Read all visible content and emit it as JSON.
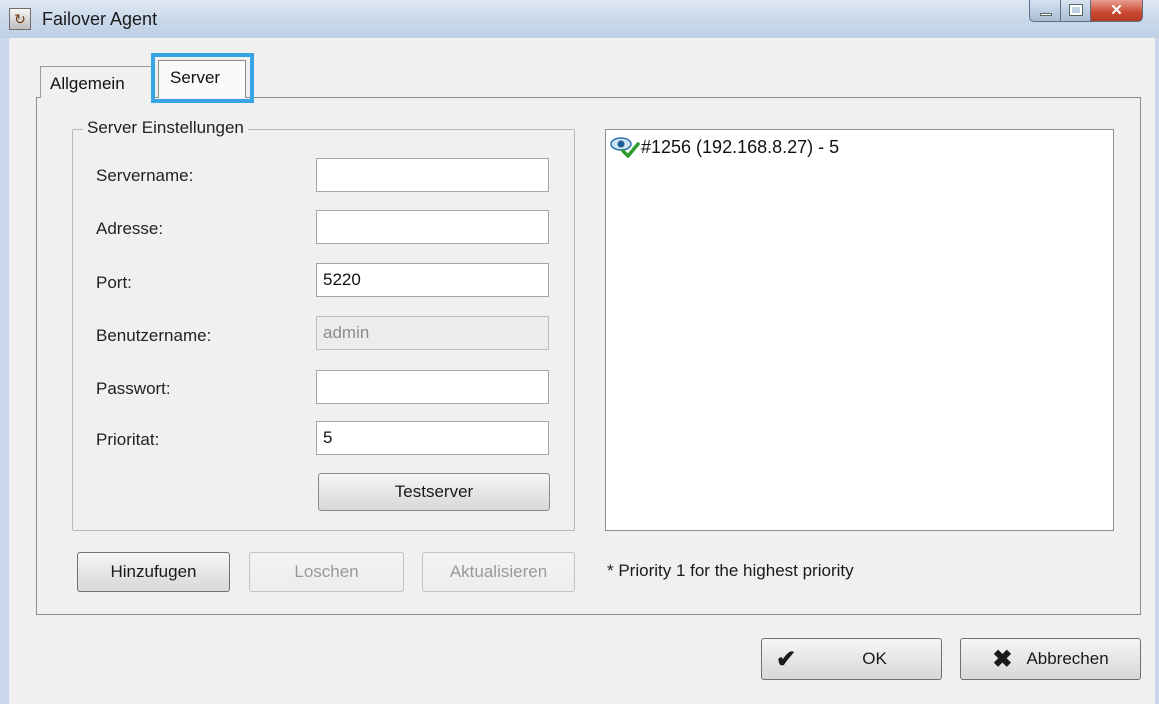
{
  "window": {
    "title": "Failover Agent"
  },
  "tabs": [
    {
      "label": "Allgemein",
      "active": false
    },
    {
      "label": "Server",
      "active": true,
      "highlight_color": "#37a5e4"
    }
  ],
  "server_settings": {
    "legend": "Server Einstellungen",
    "fields": [
      {
        "label": "Servername:",
        "value": "",
        "enabled": true
      },
      {
        "label": "Adresse:",
        "value": "",
        "enabled": true
      },
      {
        "label": "Port:",
        "value": "5220",
        "enabled": true
      },
      {
        "label": "Benutzername:",
        "value": "admin",
        "enabled": false
      },
      {
        "label": "Passwort:",
        "value": "",
        "enabled": true
      },
      {
        "label": "Prioritat:",
        "value": "5",
        "enabled": true
      }
    ],
    "test_button_label": "Testserver"
  },
  "server_list": {
    "items": [
      {
        "text": "#1256 (192.168.8.27) - 5",
        "icon": "server-online-icon"
      }
    ]
  },
  "actions": {
    "add_label": "Hinzufugen",
    "delete_label": "Loschen",
    "update_label": "Aktualisieren"
  },
  "note": "* Priority 1 for the highest priority",
  "footer": {
    "ok_label": "OK",
    "cancel_label": "Abbrechen"
  }
}
